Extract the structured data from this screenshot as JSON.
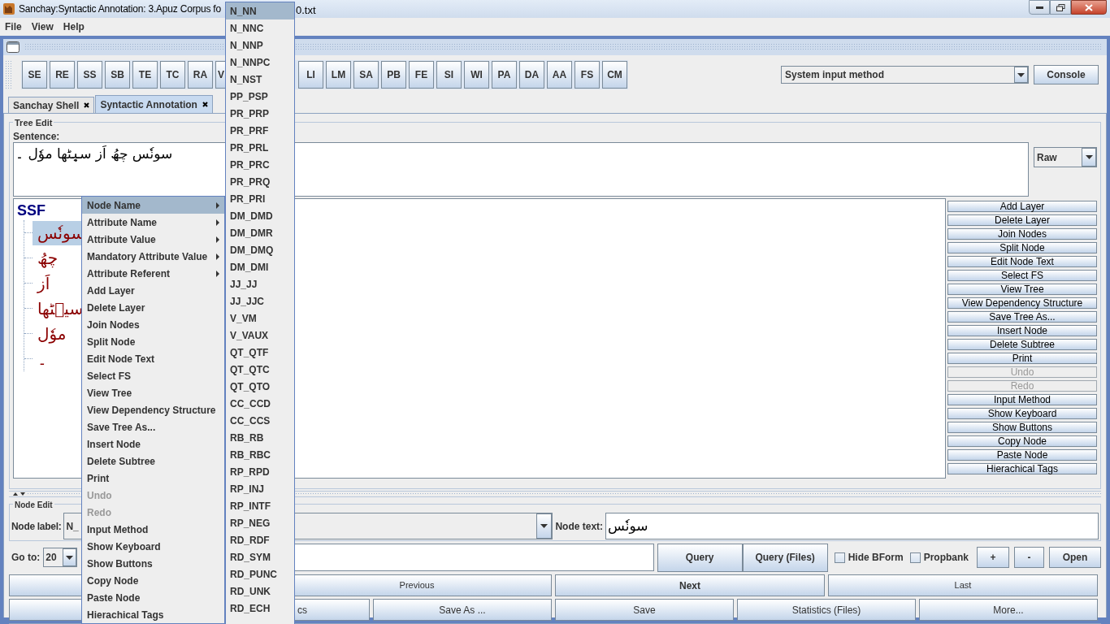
{
  "window": {
    "title": "Sanchay:Syntactic Annotation: 3.Apuz Corpus fo",
    "title_tail": "0.txt"
  },
  "menu_bar": [
    "File",
    "View",
    "Help"
  ],
  "toolbar": {
    "buttons": [
      {
        "kind": "button",
        "label": "SE"
      },
      {
        "kind": "button",
        "label": "RE"
      },
      {
        "kind": "button",
        "label": "SS"
      },
      {
        "kind": "button",
        "label": "SB"
      },
      {
        "kind": "button",
        "label": "TE"
      },
      {
        "kind": "button",
        "label": "TC"
      },
      {
        "kind": "button",
        "label": "RA"
      },
      {
        "kind": "partial",
        "label": "V"
      },
      {
        "kind": "covered"
      },
      {
        "kind": "covered"
      },
      {
        "kind": "button",
        "label": "LI"
      },
      {
        "kind": "button",
        "label": "LM"
      },
      {
        "kind": "button",
        "label": "SA"
      },
      {
        "kind": "button",
        "label": "PB"
      },
      {
        "kind": "button",
        "label": "FE"
      },
      {
        "kind": "button",
        "label": "SI"
      },
      {
        "kind": "button",
        "label": "WI"
      },
      {
        "kind": "button",
        "label": "PA"
      },
      {
        "kind": "button",
        "label": "DA"
      },
      {
        "kind": "button",
        "label": "AA"
      },
      {
        "kind": "button",
        "label": "FS"
      },
      {
        "kind": "button",
        "label": "CM"
      }
    ],
    "input_method": "System input method",
    "console": "Console"
  },
  "tabs": [
    {
      "label": "Sanchay Shell",
      "selected": false
    },
    {
      "label": "Syntactic Annotation",
      "selected": true
    }
  ],
  "tree_edit": {
    "title": "Tree Edit",
    "sentence_label": "Sentence:",
    "sentence": "سونٗس چھُ اَز سیٖٹھا موٗل ۔",
    "view_mode": "Raw",
    "tree": {
      "root": "SSF",
      "children": [
        {
          "label": "سونٗس",
          "selected": true
        },
        {
          "label": "چھُ",
          "selected": false
        },
        {
          "label": "اَز",
          "selected": false
        },
        {
          "label": "سیٖٹھا",
          "selected": false
        },
        {
          "label": "موٗل",
          "selected": false
        },
        {
          "label": "۔",
          "selected": false
        }
      ]
    },
    "actions": [
      {
        "label": "Add Layer",
        "disabled": false
      },
      {
        "label": "Delete Layer",
        "disabled": false
      },
      {
        "label": "Join Nodes",
        "disabled": false
      },
      {
        "label": "Split Node",
        "disabled": false
      },
      {
        "label": "Edit Node Text",
        "disabled": false
      },
      {
        "label": "Select FS",
        "disabled": false
      },
      {
        "label": "View Tree",
        "disabled": false
      },
      {
        "label": "View Dependency Structure",
        "disabled": false
      },
      {
        "label": "Save Tree As...",
        "disabled": false
      },
      {
        "label": "Insert Node",
        "disabled": false
      },
      {
        "label": "Delete Subtree",
        "disabled": false
      },
      {
        "label": "Print",
        "disabled": false
      },
      {
        "label": "Undo",
        "disabled": true
      },
      {
        "label": "Redo",
        "disabled": true
      },
      {
        "label": "Input Method",
        "disabled": false
      },
      {
        "label": "Show Keyboard",
        "disabled": false
      },
      {
        "label": "Show Buttons",
        "disabled": false
      },
      {
        "label": "Copy Node",
        "disabled": false
      },
      {
        "label": "Paste Node",
        "disabled": false
      },
      {
        "label": "Hierachical Tags",
        "disabled": false
      }
    ]
  },
  "node_edit": {
    "title": "Node Edit",
    "node_label_caption": "Node label:",
    "node_label": "N_",
    "node_text_caption": "Node text:",
    "node_text": "سونٗس"
  },
  "query_bar": {
    "goto_caption": "Go to:",
    "goto": "20",
    "query_buttons": [
      "Query",
      "Query (Files)"
    ],
    "checkboxes": [
      {
        "label": "Hide BForm",
        "checked": false
      },
      {
        "label": "Propbank",
        "checked": false
      }
    ],
    "small_buttons": [
      "+",
      "-",
      "Open"
    ]
  },
  "nav_rows": [
    [
      {
        "kind": "covered"
      },
      {
        "kind": "button",
        "label": "Previous",
        "default": false
      },
      {
        "kind": "button",
        "label": "Next",
        "default": true
      },
      {
        "kind": "button",
        "label": "Last",
        "default": false
      }
    ],
    [
      {
        "kind": "covered"
      },
      {
        "kind": "partial",
        "label": "cs"
      },
      {
        "kind": "button",
        "label": "Save As ..."
      },
      {
        "kind": "button",
        "label": "Save"
      },
      {
        "kind": "button",
        "label": "Statistics (Files)"
      },
      {
        "kind": "button",
        "label": "More..."
      }
    ]
  ],
  "context_menu": {
    "items": [
      {
        "label": "Node Name",
        "submenu": true,
        "selected": true,
        "disabled": false
      },
      {
        "label": "Attribute Name",
        "submenu": true,
        "selected": false,
        "disabled": false
      },
      {
        "label": "Attribute Value",
        "submenu": true,
        "selected": false,
        "disabled": false
      },
      {
        "label": "Mandatory Attribute Value",
        "submenu": true,
        "selected": false,
        "disabled": false
      },
      {
        "label": "Attribute Referent",
        "submenu": true,
        "selected": false,
        "disabled": false
      },
      {
        "label": "Add Layer",
        "submenu": false,
        "selected": false,
        "disabled": false
      },
      {
        "label": "Delete Layer",
        "submenu": false,
        "selected": false,
        "disabled": false
      },
      {
        "label": "Join Nodes",
        "submenu": false,
        "selected": false,
        "disabled": false
      },
      {
        "label": "Split Node",
        "submenu": false,
        "selected": false,
        "disabled": false
      },
      {
        "label": "Edit Node Text",
        "submenu": false,
        "selected": false,
        "disabled": false
      },
      {
        "label": "Select FS",
        "submenu": false,
        "selected": false,
        "disabled": false
      },
      {
        "label": "View Tree",
        "submenu": false,
        "selected": false,
        "disabled": false
      },
      {
        "label": "View Dependency Structure",
        "submenu": false,
        "selected": false,
        "disabled": false
      },
      {
        "label": "Save Tree As...",
        "submenu": false,
        "selected": false,
        "disabled": false
      },
      {
        "label": "Insert Node",
        "submenu": false,
        "selected": false,
        "disabled": false
      },
      {
        "label": "Delete Subtree",
        "submenu": false,
        "selected": false,
        "disabled": false
      },
      {
        "label": "Print",
        "submenu": false,
        "selected": false,
        "disabled": false
      },
      {
        "label": "Undo",
        "submenu": false,
        "selected": false,
        "disabled": true
      },
      {
        "label": "Redo",
        "submenu": false,
        "selected": false,
        "disabled": true
      },
      {
        "label": "Input Method",
        "submenu": false,
        "selected": false,
        "disabled": false
      },
      {
        "label": "Show Keyboard",
        "submenu": false,
        "selected": false,
        "disabled": false
      },
      {
        "label": "Show Buttons",
        "submenu": false,
        "selected": false,
        "disabled": false
      },
      {
        "label": "Copy Node",
        "submenu": false,
        "selected": false,
        "disabled": false
      },
      {
        "label": "Paste Node",
        "submenu": false,
        "selected": false,
        "disabled": false
      },
      {
        "label": "Hierachical Tags",
        "submenu": false,
        "selected": false,
        "disabled": false
      }
    ]
  },
  "node_name_submenu": {
    "items": [
      {
        "label": "N_NN",
        "selected": true
      },
      {
        "label": "N_NNC",
        "selected": false
      },
      {
        "label": "N_NNP",
        "selected": false
      },
      {
        "label": "N_NNPC",
        "selected": false
      },
      {
        "label": "N_NST",
        "selected": false
      },
      {
        "label": "PP_PSP",
        "selected": false
      },
      {
        "label": "PR_PRP",
        "selected": false
      },
      {
        "label": "PR_PRF",
        "selected": false
      },
      {
        "label": "PR_PRL",
        "selected": false
      },
      {
        "label": "PR_PRC",
        "selected": false
      },
      {
        "label": "PR_PRQ",
        "selected": false
      },
      {
        "label": "PR_PRI",
        "selected": false
      },
      {
        "label": "DM_DMD",
        "selected": false
      },
      {
        "label": "DM_DMR",
        "selected": false
      },
      {
        "label": "DM_DMQ",
        "selected": false
      },
      {
        "label": "DM_DMI",
        "selected": false
      },
      {
        "label": "JJ_JJ",
        "selected": false
      },
      {
        "label": "JJ_JJC",
        "selected": false
      },
      {
        "label": "V_VM",
        "selected": false
      },
      {
        "label": "V_VAUX",
        "selected": false
      },
      {
        "label": "QT_QTF",
        "selected": false
      },
      {
        "label": "QT_QTC",
        "selected": false
      },
      {
        "label": "QT_QTO",
        "selected": false
      },
      {
        "label": "CC_CCD",
        "selected": false
      },
      {
        "label": "CC_CCS",
        "selected": false
      },
      {
        "label": "RB_RB",
        "selected": false
      },
      {
        "label": "RB_RBC",
        "selected": false
      },
      {
        "label": "RP_RPD",
        "selected": false
      },
      {
        "label": "RP_INJ",
        "selected": false
      },
      {
        "label": "RP_INTF",
        "selected": false
      },
      {
        "label": "RP_NEG",
        "selected": false
      },
      {
        "label": "RD_RDF",
        "selected": false
      },
      {
        "label": "RD_SYM",
        "selected": false
      },
      {
        "label": "RD_PUNC",
        "selected": false
      },
      {
        "label": "RD_UNK",
        "selected": false
      },
      {
        "label": "RD_ECH",
        "selected": false
      }
    ]
  }
}
